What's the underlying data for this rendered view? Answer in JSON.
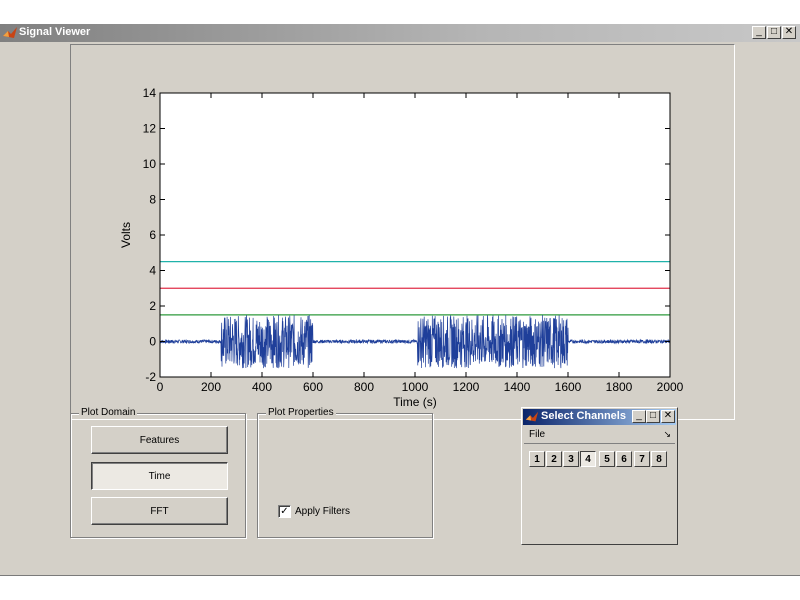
{
  "window": {
    "title": "Signal Viewer",
    "minimize": "_",
    "maximize": "□",
    "close": "✕"
  },
  "chart_data": {
    "type": "line",
    "title": "",
    "xlabel": "Time (s)",
    "ylabel": "Volts",
    "xlim": [
      0,
      2000
    ],
    "ylim": [
      -2,
      14
    ],
    "xticks": [
      0,
      200,
      400,
      600,
      800,
      1000,
      1200,
      1400,
      1600,
      1800,
      2000
    ],
    "yticks": [
      -2,
      0,
      2,
      4,
      6,
      8,
      10,
      12,
      14
    ],
    "grid": false,
    "series": [
      {
        "color": "#20b2aa",
        "x": [
          0,
          2000
        ],
        "y": [
          4.5,
          4.5
        ]
      },
      {
        "color": "#e0304a",
        "x": [
          0,
          2000
        ],
        "y": [
          3.0,
          3.0
        ]
      },
      {
        "color": "#2e9a3c",
        "x": [
          0,
          2000
        ],
        "y": [
          1.5,
          1.5
        ]
      },
      {
        "color": "#1f3f9a",
        "baseline": 0.0,
        "noise": 0.1,
        "bursts": [
          {
            "x": [
              240,
              600
            ],
            "amplitude": 1.5
          },
          {
            "x": [
              1010,
              1600
            ],
            "amplitude": 1.5
          }
        ]
      }
    ]
  },
  "plot_domain": {
    "label": "Plot Domain",
    "buttons": [
      {
        "label": "Features",
        "pressed": false
      },
      {
        "label": "Time",
        "pressed": true
      },
      {
        "label": "FFT",
        "pressed": false
      }
    ]
  },
  "plot_properties": {
    "label": "Plot Properties",
    "apply_filters": {
      "label": "Apply Filters",
      "checked": true,
      "mark": "✓"
    }
  },
  "select_channels": {
    "title": "Select Channels",
    "menu": "File",
    "menu_arrow": "↘",
    "channels": [
      "1",
      "2",
      "3",
      "4",
      "5",
      "6",
      "7",
      "8"
    ],
    "selected": "4"
  }
}
